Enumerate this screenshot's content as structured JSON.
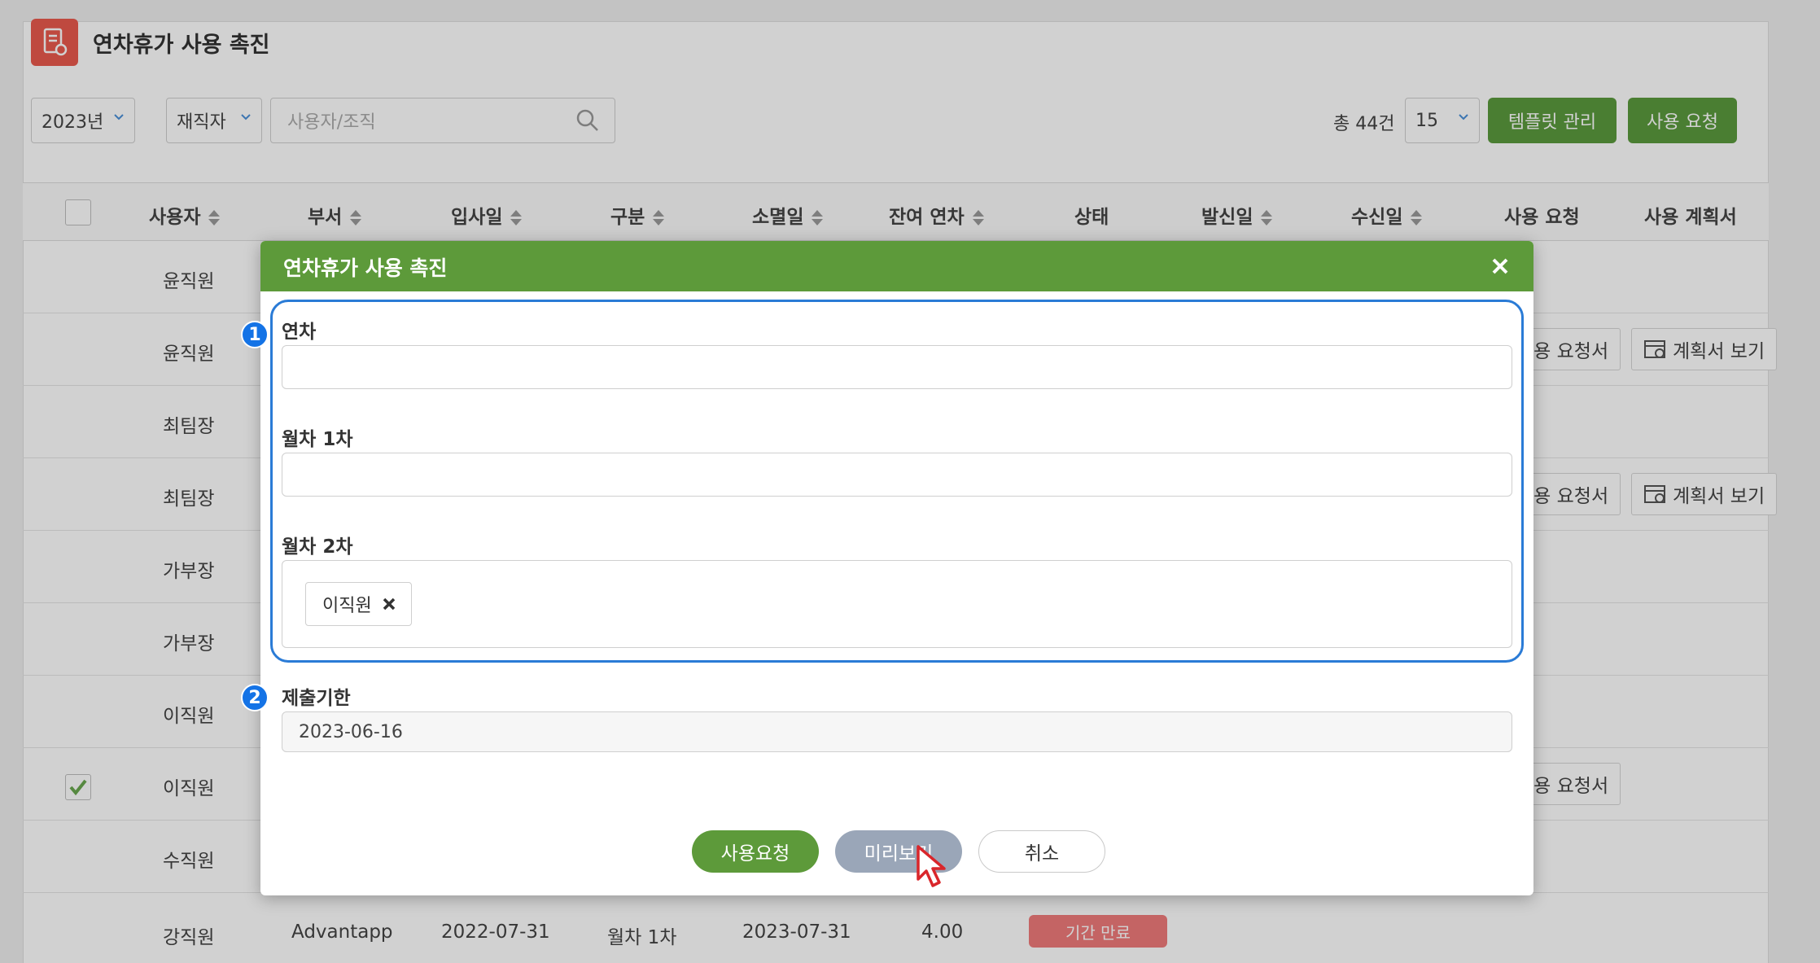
{
  "page": {
    "title": "연차휴가 사용 촉진",
    "icon": "document-icon"
  },
  "toolbar": {
    "year_select": "2023년",
    "status_select": "재직자",
    "search_placeholder": "사용자/조직",
    "total": "총 44건",
    "page_size": "15",
    "template_button": "템플릿 관리",
    "request_button": "사용 요청"
  },
  "table": {
    "headers": {
      "user": "사용자",
      "dept": "부서",
      "join_date": "입사일",
      "type": "구분",
      "expire_date": "소멸일",
      "remaining": "잔여 연차",
      "status": "상태",
      "sent_date": "발신일",
      "received_date": "수신일",
      "use_request": "사용 요청",
      "use_plan": "사용 계획서"
    },
    "rows": [
      {
        "user": "윤직원"
      },
      {
        "user": "윤직원",
        "request_btn": "사용 요청서",
        "plan_btn": "계획서 보기"
      },
      {
        "user": "최팀장"
      },
      {
        "user": "최팀장",
        "request_btn": "사용 요청서",
        "plan_btn": "계획서 보기"
      },
      {
        "user": "가부장"
      },
      {
        "user": "가부장"
      },
      {
        "user": "이직원"
      },
      {
        "user": "이직원",
        "checked": true,
        "request_btn": "사용 요청서"
      },
      {
        "user": "수직원"
      },
      {
        "user": "강직원",
        "dept": "Advantapp",
        "join_date": "2022-07-31",
        "type": "월차 1차",
        "expire_date": "2023-07-31",
        "remaining": "4.00",
        "status": "기간 만료"
      }
    ]
  },
  "modal": {
    "title": "연차휴가 사용 촉진",
    "fields": {
      "annual_label": "연차",
      "annual_value": "",
      "monthly1_label": "월차 1차",
      "monthly1_value": "",
      "monthly2_label": "월차 2차",
      "monthly2_tag": "이직원",
      "deadline_label": "제출기한",
      "deadline_value": "2023-06-16"
    },
    "markers": [
      "1",
      "2"
    ],
    "buttons": {
      "request": "사용요청",
      "preview": "미리보기",
      "cancel": "취소"
    }
  },
  "colors": {
    "green": "#5d9a3a",
    "highlight_blue": "#2a7bd6",
    "marker_blue": "#1473e6",
    "preview_gray": "#9aa6b8",
    "expired_badge": "#ef7b7b"
  }
}
